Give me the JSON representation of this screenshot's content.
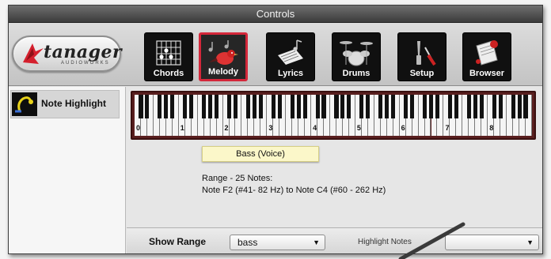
{
  "window": {
    "title": "Controls"
  },
  "logo": {
    "brand": "tanager",
    "subtitle": "AUDIOWORKS"
  },
  "toolbar": {
    "buttons": [
      {
        "label": "Chords",
        "icon": "guitar-chord-icon",
        "active": false
      },
      {
        "label": "Melody",
        "icon": "bird-notes-icon",
        "active": true
      },
      {
        "label": "Lyrics",
        "icon": "lyrics-sheet-icon",
        "active": false
      },
      {
        "label": "Drums",
        "icon": "drum-kit-icon",
        "active": false
      },
      {
        "label": "Setup",
        "icon": "wrench-screwdriver-icon",
        "active": false
      },
      {
        "label": "Browser",
        "icon": "browser-book-icon",
        "active": false
      }
    ]
  },
  "sidebar": {
    "items": [
      {
        "label": "Note Highlight",
        "icon": "note-highlight-icon"
      }
    ]
  },
  "keyboard": {
    "octave_labels": [
      "0",
      "1",
      "2",
      "3",
      "4",
      "5",
      "6",
      "7",
      "8"
    ]
  },
  "popup": {
    "text": "Bass (Voice)"
  },
  "info": {
    "range": "Range - 25 Notes:",
    "notes": "Note F2 (#41- 82 Hz) to Note C4 (#60 - 262 Hz)"
  },
  "bottom": {
    "show_range_label": "Show Range",
    "show_range_value": "bass",
    "highlight_notes_label": "Highlight Notes",
    "highlight_notes_value": ""
  },
  "colors": {
    "active_border": "#d4273a",
    "popup_bg": "#fbf7c9",
    "keyboard_frame": "#5a1f1f"
  }
}
